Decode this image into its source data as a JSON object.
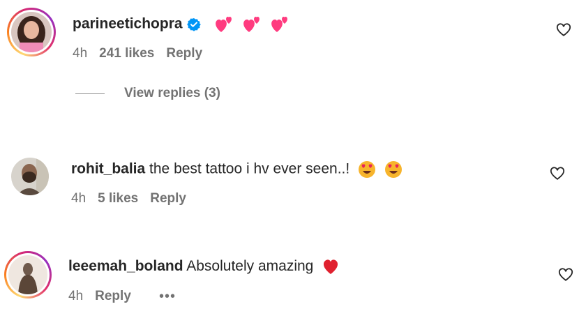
{
  "comments": [
    {
      "username": "parineetichopra",
      "text": "",
      "verified": true,
      "time": "4h",
      "likes": "241 likes",
      "reply": "Reply",
      "emojis": [
        "two-hearts",
        "two-hearts",
        "two-hearts"
      ],
      "view_replies": "View replies (3)"
    },
    {
      "username": "rohit_balia",
      "text": "the best tattoo i hv ever seen..!",
      "time": "4h",
      "likes": "5 likes",
      "reply": "Reply",
      "emojis": [
        "heart-eyes",
        "heart-eyes"
      ]
    },
    {
      "username": "leeemah_boland",
      "text": "Absolutely amazing",
      "time": "4h",
      "reply": "Reply",
      "more": "•••",
      "emojis": [
        "red-heart"
      ]
    }
  ],
  "colors": {
    "text": "#262626",
    "secondary": "#737373",
    "verified": "#0095f6",
    "pink_heart": "#ff3b7f",
    "red_heart": "#e0212f"
  }
}
